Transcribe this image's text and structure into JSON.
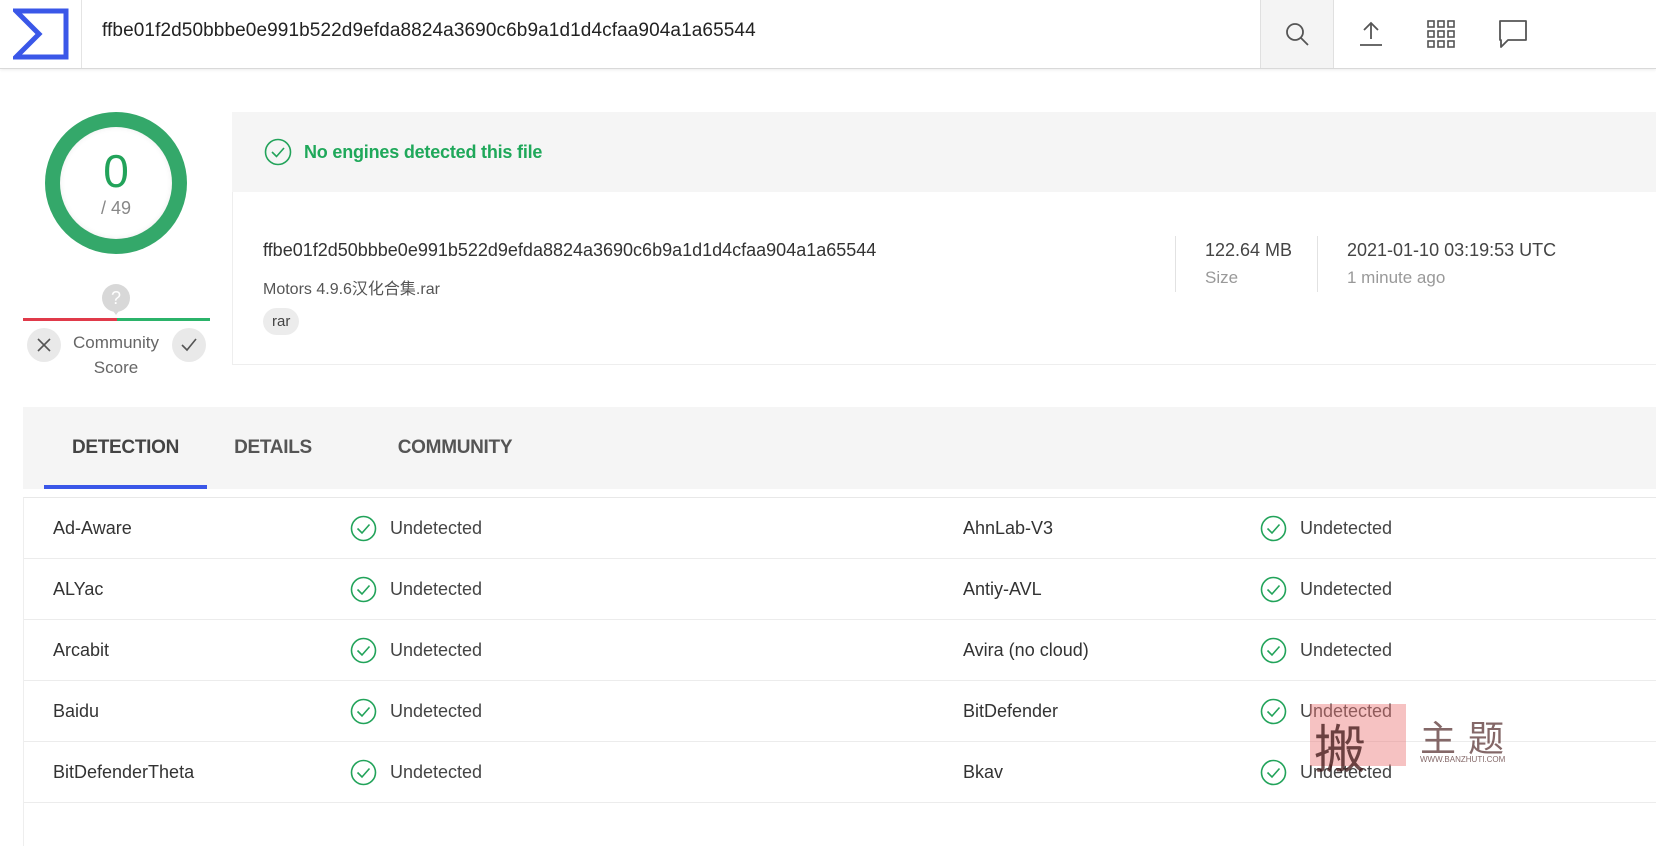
{
  "header": {
    "search_value": "ffbe01f2d50bbbe0e991b522d9efda8824a3690c6b9a1d1d4cfaa904a1a65544",
    "icons": [
      "logo-icon",
      "search-icon",
      "upload-icon",
      "apps-grid-icon",
      "chat-icon"
    ]
  },
  "score": {
    "detected": "0",
    "total": "/ 49",
    "community_label": "Community Score",
    "community_question": "?"
  },
  "banner": {
    "text": "No engines detected this file"
  },
  "file": {
    "hash": "ffbe01f2d50bbbe0e991b522d9efda8824a3690c6b9a1d1d4cfaa904a1a65544",
    "name": "Motors 4.9.6汉化合集.rar",
    "tag": "rar",
    "size": "122.64 MB",
    "size_label": "Size",
    "date": "2021-01-10 03:19:53 UTC",
    "date_ago": "1 minute ago"
  },
  "tabs": [
    "DETECTION",
    "DETAILS",
    "COMMUNITY"
  ],
  "detections": [
    {
      "left": "Ad-Aware",
      "left_status": "Undetected",
      "right": "AhnLab-V3",
      "right_status": "Undetected"
    },
    {
      "left": "ALYac",
      "left_status": "Undetected",
      "right": "Antiy-AVL",
      "right_status": "Undetected"
    },
    {
      "left": "Arcabit",
      "left_status": "Undetected",
      "right": "Avira (no cloud)",
      "right_status": "Undetected"
    },
    {
      "left": "Baidu",
      "left_status": "Undetected",
      "right": "BitDefender",
      "right_status": "Undetected"
    },
    {
      "left": "BitDefenderTheta",
      "left_status": "Undetected",
      "right": "Bkav",
      "right_status": "Undetected"
    }
  ],
  "watermark": {
    "char1": "搬",
    "chars": "主题",
    "url": "WWW.BANZHUTI.COM"
  },
  "colors": {
    "accent_blue": "#3a57e8",
    "success_green": "#22a35a",
    "negative_red": "#e03a4a"
  }
}
